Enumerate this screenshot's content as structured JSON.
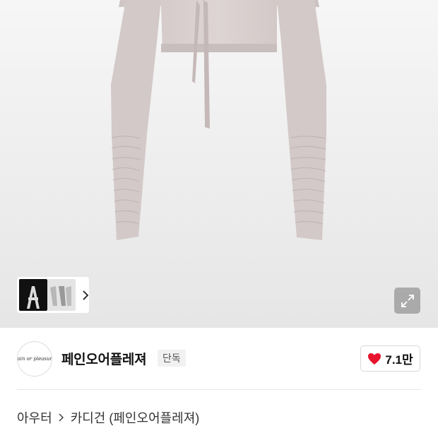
{
  "product": {
    "image_alt": "cropped long-sleeve cardigan with tie front"
  },
  "gallery": {
    "thumbnail_count": 2,
    "next_icon": "chevron-right-icon",
    "expand_icon": "expand-icon"
  },
  "brand": {
    "logo_text": "Pain or pleasure",
    "name": "페인오어플레져",
    "exclusive_badge": "단독",
    "like_icon": "heart-icon",
    "like_count": "7.1만",
    "like_color": "#e8132c"
  },
  "breadcrumb": {
    "items": [
      "아우터",
      "카디건 (페인오어플레져)"
    ],
    "separator_icon": "chevron-right-icon"
  }
}
